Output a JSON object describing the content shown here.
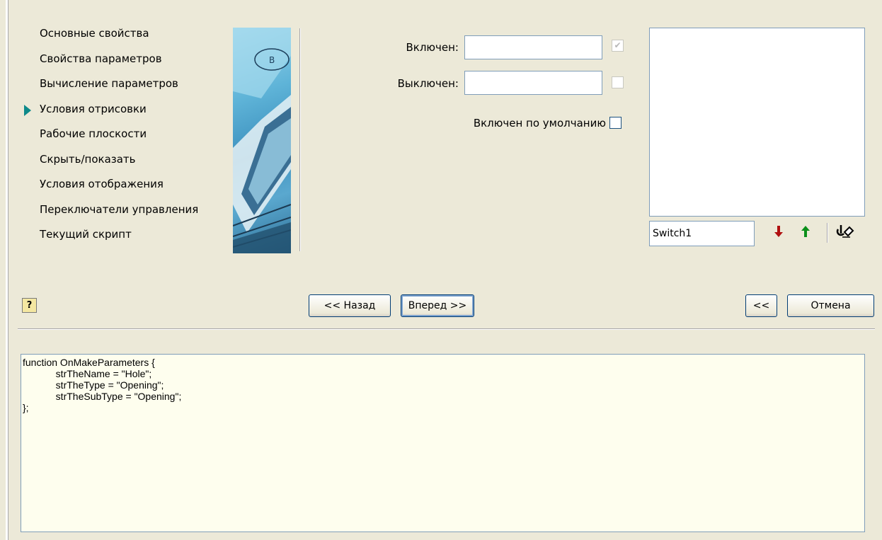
{
  "nav": {
    "items": [
      {
        "label": "Основные свойства"
      },
      {
        "label": "Свойства параметров"
      },
      {
        "label": "Вычисление параметров"
      },
      {
        "label": "Условия отрисовки"
      },
      {
        "label": "Рабочие плоскости"
      },
      {
        "label": "Скрыть/показать"
      },
      {
        "label": "Условия отображения"
      },
      {
        "label": "Переключатели управления"
      },
      {
        "label": "Текущий скрипт"
      }
    ],
    "active_index": 3
  },
  "fields": {
    "on_label": "Включен:",
    "on_value": "",
    "off_label": "Выключен:",
    "off_value": "",
    "default_on_label": "Включен по умолчанию"
  },
  "switch_list": {
    "name_value": "Switch1"
  },
  "buttons": {
    "back": "<< Назад",
    "next": "Вперед >>",
    "collapse": "<<",
    "cancel": "Отмена",
    "help": "?"
  },
  "code": {
    "text": "function OnMakeParameters {\n            strTheName = \"Hole\";\n            strTheType = \"Opening\";\n            strTheSubType = \"Opening\";\n};"
  },
  "colors": {
    "background": "#ece9d8",
    "nav_arrow": "#0e8a8a",
    "move_down_arrow": "#b01010",
    "move_up_arrow": "#0a8f1a",
    "code_background": "#fefeee"
  },
  "icons": {
    "active_marker": "triangle-right-icon",
    "move_down": "arrow-down-icon",
    "move_up": "arrow-up-icon",
    "eraser": "eraser-icon",
    "help": "help-icon",
    "checkmark": "check-icon"
  }
}
